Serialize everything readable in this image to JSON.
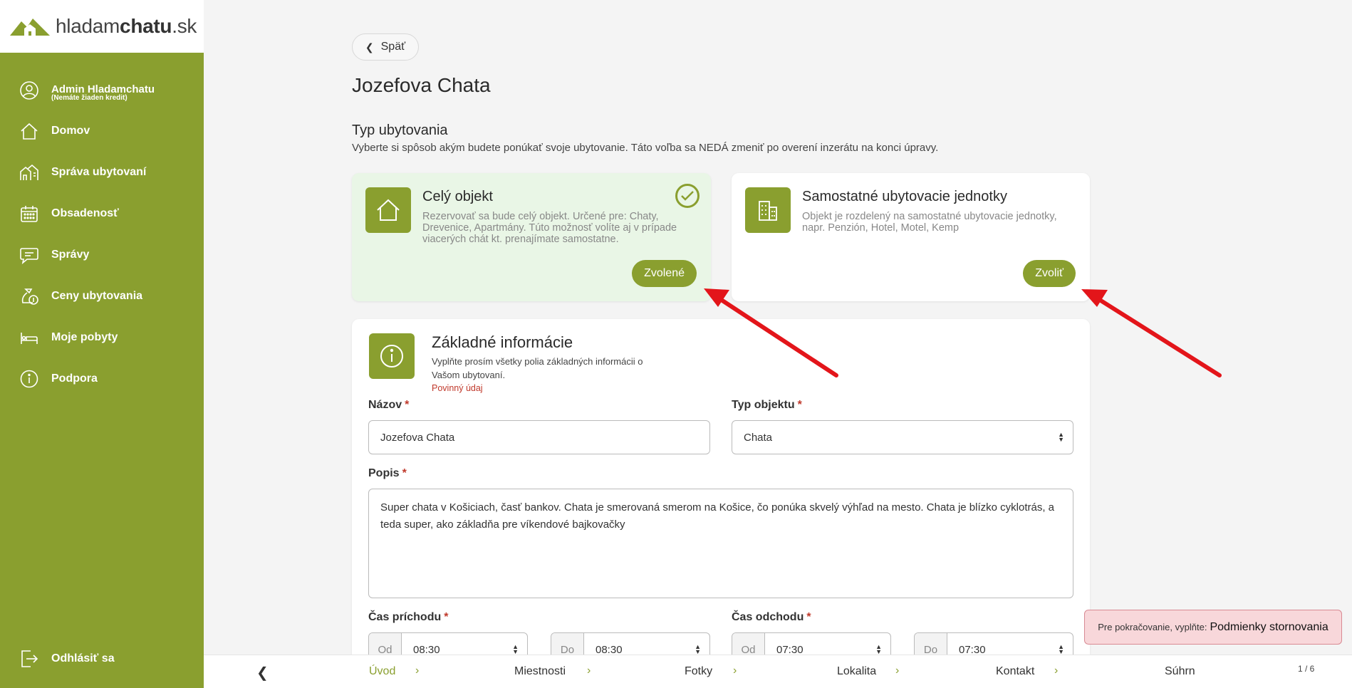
{
  "logo": {
    "part1": "hladam",
    "part2": "chatu",
    "part3": ".sk"
  },
  "sidebar": {
    "user_name": "Admin Hladamchatu",
    "user_sub": "(Nemáte žiaden kredit)",
    "items": [
      {
        "label": "Domov",
        "icon": "home-icon"
      },
      {
        "label": "Správa ubytovaní",
        "icon": "buildings-icon"
      },
      {
        "label": "Obsadenosť",
        "icon": "calendar-icon"
      },
      {
        "label": "Správy",
        "icon": "chat-icon"
      },
      {
        "label": "Ceny ubytovania",
        "icon": "money-bag-icon"
      },
      {
        "label": "Moje pobyty",
        "icon": "bed-icon"
      },
      {
        "label": "Podpora",
        "icon": "info-icon"
      }
    ],
    "logout": "Odhlásiť sa"
  },
  "back_label": "Späť",
  "page_title": "Jozefova Chata",
  "type_section": {
    "title": "Typ ubytovania",
    "subtitle": "Vyberte si spôsob akým budete ponúkať svoje ubytovanie. Táto voľba sa NEDÁ zmeniť po overení inzerátu na konci úpravy."
  },
  "cards": [
    {
      "title": "Celý objekt",
      "desc": "Rezervovať sa bude celý objekt. Určené pre: Chaty, Drevenice, Apartmány. Túto možnosť volíte aj v prípade viacerých chát kt. prenajímate samostatne.",
      "button": "Zvolené",
      "selected": true
    },
    {
      "title": "Samostatné ubytovacie jednotky",
      "desc": "Objekt je rozdelený na samostatné ubytovacie jednotky, napr. Penzión, Hotel, Motel, Kemp",
      "button": "Zvoliť",
      "selected": false
    }
  ],
  "basic_info": {
    "title": "Základné informácie",
    "subtitle": "Vyplňte prosím všetky polia základných informácii o Vašom ubytovaní.",
    "required_note": "Povinný údaj"
  },
  "form": {
    "name_label": "Názov",
    "name_value": "Jozefova Chata",
    "type_label": "Typ objektu",
    "type_value": "Chata",
    "desc_label": "Popis",
    "desc_value": "Super chata v Košiciach, časť bankov. Chata je smerovaná smerom na Košice, čo ponúka skvelý výhľad na mesto. Chata je blízko cyklotrás, a teda super, ako základňa pre víkendové bajkovačky",
    "arrival_label": "Čas príchodu",
    "departure_label": "Čas odchodu",
    "from_prefix": "Od",
    "to_prefix": "Do",
    "arrival_from": "08:30",
    "arrival_to": "08:30",
    "departure_from": "07:30",
    "departure_to": "07:30",
    "required_mark": "*"
  },
  "toast": {
    "prefix": "Pre pokračovanie, vyplňte:",
    "field": "Podmienky stornovania"
  },
  "stepper": {
    "steps": [
      "Úvod",
      "Miestnosti",
      "Fotky",
      "Lokalita",
      "Kontakt",
      "Súhrn"
    ],
    "counter": "1 / 6"
  },
  "colors": {
    "brand": "#8a9f2f",
    "selected_card": "#e9f6e6",
    "required": "#c0392b",
    "toast_bg": "#f8d7da",
    "annotation_arrow": "#e3151a"
  }
}
